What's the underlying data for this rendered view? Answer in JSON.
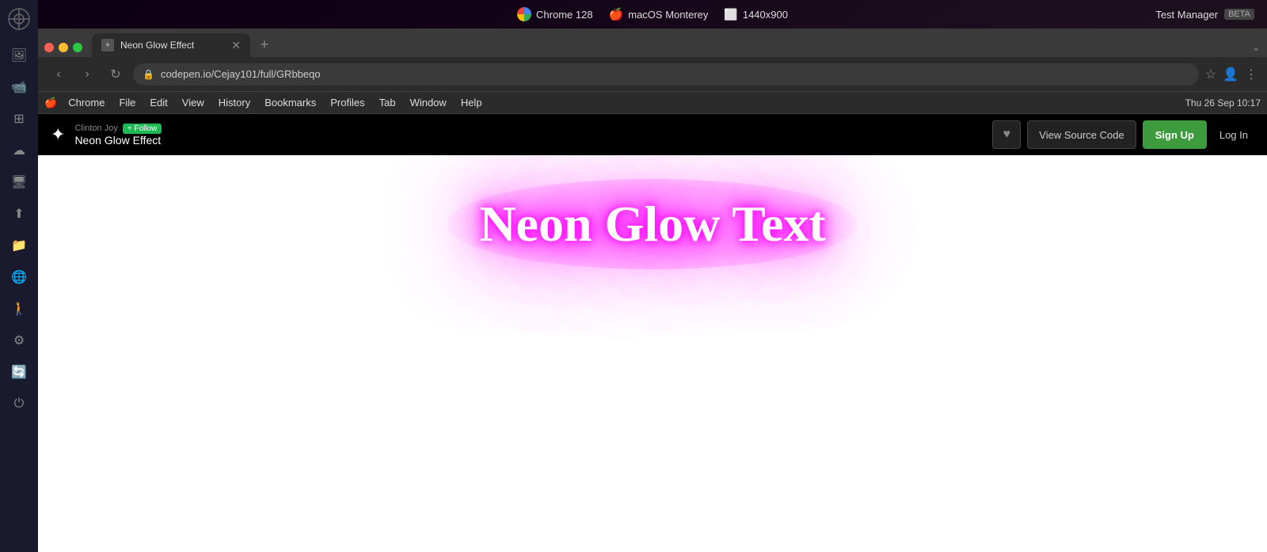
{
  "sidebar": {
    "icons": [
      "⬡",
      "🖼",
      "🎬",
      "✦",
      "☁",
      "💻",
      "⬆",
      "📁",
      "🌐",
      "🚶",
      "⚙",
      "🔄",
      "⏻"
    ]
  },
  "system_bar": {
    "browser_label": "Chrome 128",
    "os_label": "macOS Monterey",
    "resolution": "1440x900",
    "test_manager": "Test Manager",
    "beta_label": "BETA"
  },
  "browser": {
    "tab_title": "Neon Glow Effect",
    "url": "codepen.io/Cejay101/full/GRbbeqo",
    "menu_items": [
      "Chrome",
      "File",
      "Edit",
      "View",
      "History",
      "Bookmarks",
      "Profiles",
      "Tab",
      "Window",
      "Help"
    ],
    "datetime": "Thu 26 Sep  10:17"
  },
  "codepen": {
    "author": "Clinton Joy",
    "follow_label": "+ Follow",
    "pen_title": "Neon Glow Effect",
    "view_source_label": "View Source Code",
    "signup_label": "Sign Up",
    "login_label": "Log In",
    "heart_icon": "♥"
  },
  "preview": {
    "neon_text": "Neon Glow Text"
  }
}
